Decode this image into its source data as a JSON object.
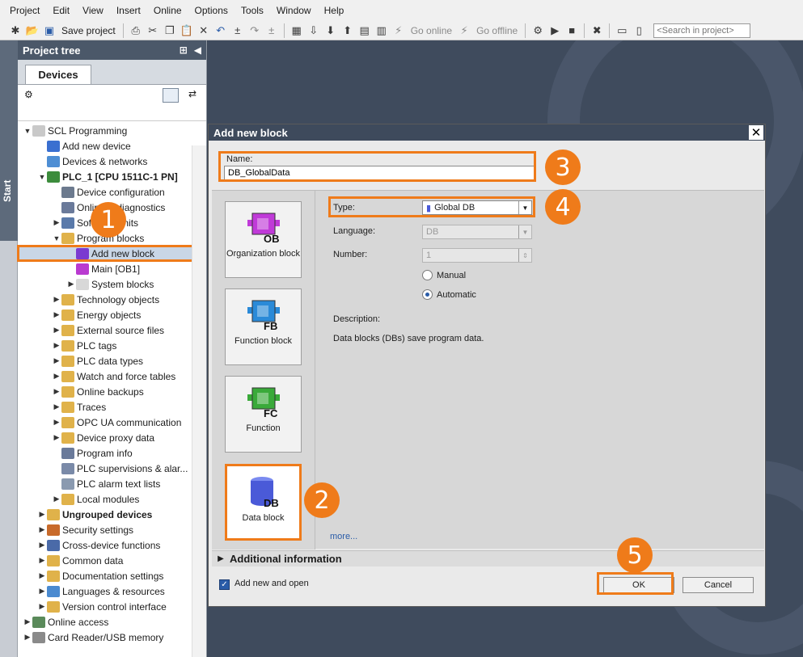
{
  "menubar": {
    "items": [
      "Project",
      "Edit",
      "View",
      "Insert",
      "Online",
      "Options",
      "Tools",
      "Window",
      "Help"
    ]
  },
  "toolbar": {
    "save_label": "Save project",
    "go_online": "Go online",
    "go_offline": "Go offline",
    "search_placeholder": "<Search in project>"
  },
  "start_label": "Start",
  "project_tree": {
    "title": "Project tree",
    "tab": "Devices",
    "rows": [
      {
        "label": "SCL Programming",
        "indent": 0,
        "arrow": "down",
        "icon": "project-icon",
        "color": "#c9c9c9"
      },
      {
        "label": "Add new device",
        "indent": 1,
        "arrow": "",
        "icon": "add-device-icon",
        "color": "#3a6fd0"
      },
      {
        "label": "Devices & networks",
        "indent": 1,
        "arrow": "",
        "icon": "network-icon",
        "color": "#4e8ed4"
      },
      {
        "label": "PLC_1 [CPU 1511C-1 PN]",
        "indent": 1,
        "arrow": "down",
        "icon": "plc-icon",
        "color": "#3c8c3c",
        "bold": true
      },
      {
        "label": "Device configuration",
        "indent": 2,
        "arrow": "",
        "icon": "config-icon",
        "color": "#6c7a8e"
      },
      {
        "label": "Online & diagnostics",
        "indent": 2,
        "arrow": "",
        "icon": "diagnostics-icon",
        "color": "#6a7a9a"
      },
      {
        "label": "Software units",
        "indent": 2,
        "arrow": "right",
        "icon": "units-icon",
        "color": "#5a7aaa"
      },
      {
        "label": "Program blocks",
        "indent": 2,
        "arrow": "down",
        "icon": "folder-icon",
        "color": "#e0b24a"
      },
      {
        "label": "Add new block",
        "indent": 3,
        "arrow": "",
        "icon": "add-block-icon",
        "color": "#7a3ad0",
        "selected": true
      },
      {
        "label": "Main [OB1]",
        "indent": 3,
        "arrow": "",
        "icon": "ob-icon",
        "color": "#b93ad0"
      },
      {
        "label": "System blocks",
        "indent": 3,
        "arrow": "right",
        "icon": "folder-icon",
        "color": "#d8d8d8"
      },
      {
        "label": "Technology objects",
        "indent": 2,
        "arrow": "right",
        "icon": "folder-icon",
        "color": "#e0b24a"
      },
      {
        "label": "Energy objects",
        "indent": 2,
        "arrow": "right",
        "icon": "folder-icon",
        "color": "#e0b24a"
      },
      {
        "label": "External source files",
        "indent": 2,
        "arrow": "right",
        "icon": "folder-icon",
        "color": "#e0b24a"
      },
      {
        "label": "PLC tags",
        "indent": 2,
        "arrow": "right",
        "icon": "folder-icon",
        "color": "#e0b24a"
      },
      {
        "label": "PLC data types",
        "indent": 2,
        "arrow": "right",
        "icon": "folder-icon",
        "color": "#e0b24a"
      },
      {
        "label": "Watch and force tables",
        "indent": 2,
        "arrow": "right",
        "icon": "folder-icon",
        "color": "#e0b24a"
      },
      {
        "label": "Online backups",
        "indent": 2,
        "arrow": "right",
        "icon": "folder-icon",
        "color": "#e0b24a"
      },
      {
        "label": "Traces",
        "indent": 2,
        "arrow": "right",
        "icon": "folder-icon",
        "color": "#e0b24a"
      },
      {
        "label": "OPC UA communication",
        "indent": 2,
        "arrow": "right",
        "icon": "folder-icon",
        "color": "#e0b24a"
      },
      {
        "label": "Device proxy data",
        "indent": 2,
        "arrow": "right",
        "icon": "folder-icon",
        "color": "#e0b24a"
      },
      {
        "label": "Program info",
        "indent": 2,
        "arrow": "",
        "icon": "info-icon",
        "color": "#6a7a9a"
      },
      {
        "label": "PLC supervisions & alar...",
        "indent": 2,
        "arrow": "",
        "icon": "alarm-icon",
        "color": "#7a8aa8"
      },
      {
        "label": "PLC alarm text lists",
        "indent": 2,
        "arrow": "",
        "icon": "list-icon",
        "color": "#8a9ab0"
      },
      {
        "label": "Local modules",
        "indent": 2,
        "arrow": "right",
        "icon": "folder-icon",
        "color": "#e0b24a"
      },
      {
        "label": "Ungrouped devices",
        "indent": 1,
        "arrow": "right",
        "icon": "folder-icon",
        "color": "#e0b24a",
        "bold": true
      },
      {
        "label": "Security settings",
        "indent": 1,
        "arrow": "right",
        "icon": "security-icon",
        "color": "#c86a2a"
      },
      {
        "label": "Cross-device functions",
        "indent": 1,
        "arrow": "right",
        "icon": "cross-device-icon",
        "color": "#4a6aa8"
      },
      {
        "label": "Common data",
        "indent": 1,
        "arrow": "right",
        "icon": "common-data-icon",
        "color": "#e0b24a"
      },
      {
        "label": "Documentation settings",
        "indent": 1,
        "arrow": "right",
        "icon": "doc-icon",
        "color": "#e0b24a"
      },
      {
        "label": "Languages & resources",
        "indent": 1,
        "arrow": "right",
        "icon": "languages-icon",
        "color": "#4a8ad0"
      },
      {
        "label": "Version control interface",
        "indent": 1,
        "arrow": "right",
        "icon": "version-icon",
        "color": "#e0b24a"
      },
      {
        "label": "Online access",
        "indent": 0,
        "arrow": "right",
        "icon": "online-access-icon",
        "color": "#5a8a5a"
      },
      {
        "label": "Card Reader/USB memory",
        "indent": 0,
        "arrow": "right",
        "icon": "card-reader-icon",
        "color": "#8a8a8a"
      }
    ]
  },
  "dialog": {
    "title": "Add new block",
    "name_label": "Name:",
    "name_value": "DB_GlobalData",
    "blocks": [
      {
        "label": "Organization block",
        "abbr": "OB",
        "color": "#c03ad8"
      },
      {
        "label": "Function block",
        "abbr": "FB",
        "color": "#2a8ad8"
      },
      {
        "label": "Function",
        "abbr": "FC",
        "color": "#3aaa3a"
      },
      {
        "label": "Data block",
        "abbr": "DB",
        "color": "#4a5ad8"
      }
    ],
    "type_label": "Type:",
    "type_value": "Global DB",
    "language_label": "Language:",
    "language_value": "DB",
    "number_label": "Number:",
    "number_value": "1",
    "manual_label": "Manual",
    "automatic_label": "Automatic",
    "description_label": "Description:",
    "description_text": "Data blocks (DBs) save program data.",
    "more_link": "more...",
    "additional_info": "Additional information",
    "add_new_and_open": "Add new and open",
    "ok": "OK",
    "cancel": "Cancel"
  },
  "badges": [
    "1",
    "2",
    "3",
    "4",
    "5"
  ],
  "colors": {
    "accent": "#ef7b1a",
    "header": "#4b5869",
    "selection": "#c9d6e6"
  }
}
